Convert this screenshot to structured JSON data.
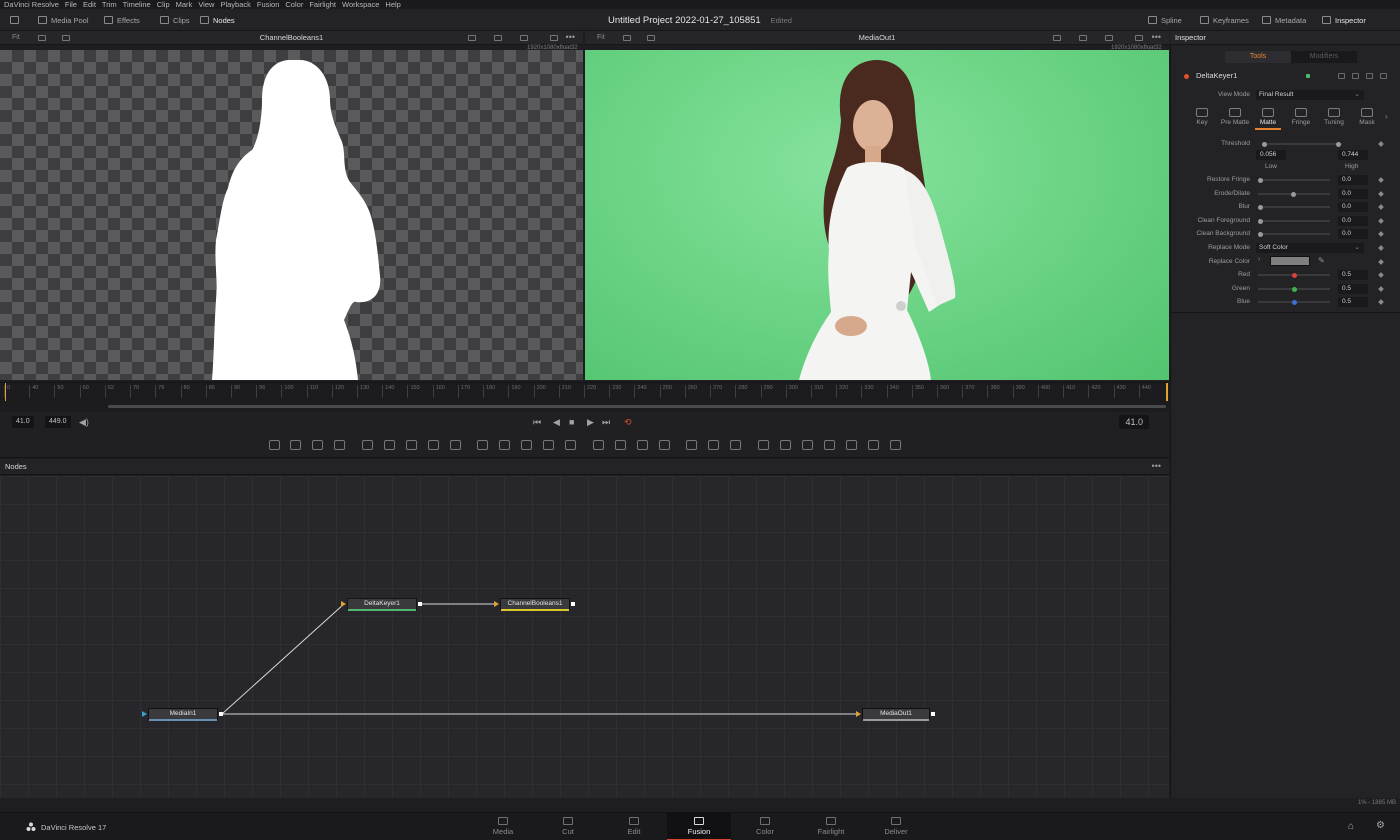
{
  "menu": [
    "DaVinci Resolve",
    "File",
    "Edit",
    "Trim",
    "Timeline",
    "Clip",
    "Mark",
    "View",
    "Playback",
    "Fusion",
    "Color",
    "Fairlight",
    "Workspace",
    "Help"
  ],
  "toolbar": {
    "left": [
      {
        "label": "Media Pool",
        "icon": "media-pool-icon"
      },
      {
        "label": "Effects",
        "icon": "effects-icon"
      },
      {
        "label": "Clips",
        "icon": "clips-icon"
      },
      {
        "label": "Nodes",
        "icon": "nodes-icon"
      }
    ],
    "project_title": "Untitled Project 2022-01-27_105851",
    "edited_label": "Edited",
    "right": [
      {
        "label": "Spline",
        "icon": "spline-icon"
      },
      {
        "label": "Keyframes",
        "icon": "keyframes-icon"
      },
      {
        "label": "Metadata",
        "icon": "metadata-icon"
      },
      {
        "label": "Inspector",
        "icon": "inspector-icon"
      }
    ]
  },
  "viewer_left": {
    "fit": "Fit",
    "name": "ChannelBooleans1",
    "resolution": "1920x1080xfloat32"
  },
  "viewer_right": {
    "fit": "Fit",
    "name": "MediaOut1",
    "resolution": "1920x1080xfloat32"
  },
  "ruler_ticks": [
    "0",
    "40",
    "50",
    "60",
    "62",
    "70",
    "76",
    "80",
    "86",
    "90",
    "96",
    "100",
    "110",
    "120",
    "130",
    "140",
    "150",
    "160",
    "170",
    "180",
    "190",
    "200",
    "210",
    "220",
    "230",
    "240",
    "250",
    "260",
    "270",
    "280",
    "290",
    "300",
    "310",
    "320",
    "330",
    "340",
    "350",
    "360",
    "370",
    "380",
    "390",
    "400",
    "410",
    "420",
    "430",
    "440"
  ],
  "transport": {
    "current": "41.0",
    "end": "449.0",
    "timecode": "41.0"
  },
  "nodes_panel": {
    "title": "Nodes",
    "nodes": [
      {
        "id": "DeltaKeyer1",
        "label": "DeltaKeyer1"
      },
      {
        "id": "ChannelBooleans1",
        "label": "ChannelBooleans1"
      },
      {
        "id": "MediaIn1",
        "label": "MediaIn1"
      },
      {
        "id": "MediaOut1",
        "label": "MediaOut1"
      }
    ]
  },
  "inspector": {
    "title": "Inspector",
    "tabs": [
      "Tools",
      "Modifiers"
    ],
    "tool_name": "DeltaKeyer1",
    "view_mode_label": "View Mode",
    "view_mode_value": "Final Result",
    "subtabs": [
      "Key",
      "Pre Matte",
      "Matte",
      "Fringe",
      "Tuning",
      "Mask"
    ],
    "threshold_label": "Threshold",
    "threshold_low": "0.056",
    "threshold_high": "0.744",
    "low_label": "Low",
    "high_label": "High",
    "params": [
      {
        "label": "Restore Fringe",
        "value": "0.0"
      },
      {
        "label": "Erode/Dilate",
        "value": "0.0"
      },
      {
        "label": "Blur",
        "value": "0.0"
      },
      {
        "label": "Clean Foreground",
        "value": "0.0"
      },
      {
        "label": "Clean Background",
        "value": "0.0"
      }
    ],
    "replace_mode_label": "Replace Mode",
    "replace_mode_value": "Soft Color",
    "replace_color_label": "Replace Color",
    "rgb": [
      {
        "label": "Red",
        "value": "0.5"
      },
      {
        "label": "Green",
        "value": "0.5"
      },
      {
        "label": "Blue",
        "value": "0.5"
      }
    ]
  },
  "memory": "1% - 1885 MB",
  "pagebar": {
    "brand": "DaVinci Resolve 17",
    "pages": [
      "Media",
      "Cut",
      "Edit",
      "Fusion",
      "Color",
      "Fairlight",
      "Deliver"
    ],
    "active": "Fusion"
  },
  "colors": {
    "accent": "#e78330",
    "playhead": "#e0a230",
    "active_page_underline": "#e0402e",
    "green_screen": "#6ed587"
  }
}
